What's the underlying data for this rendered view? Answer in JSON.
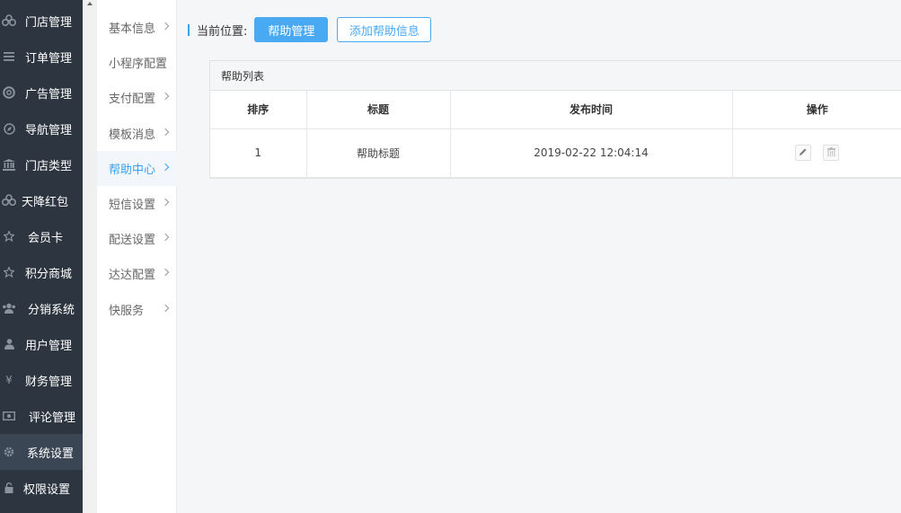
{
  "sidebar": {
    "items": [
      {
        "label": "门店管理",
        "icon": "store-icon"
      },
      {
        "label": "订单管理",
        "icon": "list-icon"
      },
      {
        "label": "广告管理",
        "icon": "lifebuoy-icon"
      },
      {
        "label": "导航管理",
        "icon": "compass-icon"
      },
      {
        "label": "门店类型",
        "icon": "bank-icon"
      },
      {
        "label": "天降红包",
        "icon": "redpacket-icon"
      },
      {
        "label": "会员卡",
        "icon": "star-icon"
      },
      {
        "label": "积分商城",
        "icon": "star-icon"
      },
      {
        "label": "分销系统",
        "icon": "users-icon"
      },
      {
        "label": "用户管理",
        "icon": "user-icon"
      },
      {
        "label": "财务管理",
        "icon": "yen-icon"
      },
      {
        "label": "评论管理",
        "icon": "money-icon"
      },
      {
        "label": "系统设置",
        "icon": "gear-icon",
        "active": true
      },
      {
        "label": "权限设置",
        "icon": "lock-icon"
      }
    ]
  },
  "submenu": {
    "items": [
      {
        "label": "基本信息",
        "arrow": true
      },
      {
        "label": "小程序配置",
        "arrow": false
      },
      {
        "label": "支付配置",
        "arrow": true
      },
      {
        "label": "模板消息",
        "arrow": true
      },
      {
        "label": "帮助中心",
        "arrow": true,
        "active": true
      },
      {
        "label": "短信设置",
        "arrow": true
      },
      {
        "label": "配送设置",
        "arrow": true
      },
      {
        "label": "达达配置",
        "arrow": true
      },
      {
        "label": "快服务",
        "arrow": true
      }
    ]
  },
  "breadcrumb": {
    "label": "当前位置:",
    "current": "帮助管理",
    "add_button": "添加帮助信息"
  },
  "panel": {
    "title": "帮助列表",
    "columns": [
      "排序",
      "标题",
      "发布时间",
      "操作"
    ],
    "rows": [
      {
        "order": "1",
        "title": "帮助标题",
        "time": "2019-02-22 12:04:14"
      }
    ]
  },
  "colors": {
    "accent": "#4aa9f3",
    "sidebar_bg": "#2d3640"
  }
}
